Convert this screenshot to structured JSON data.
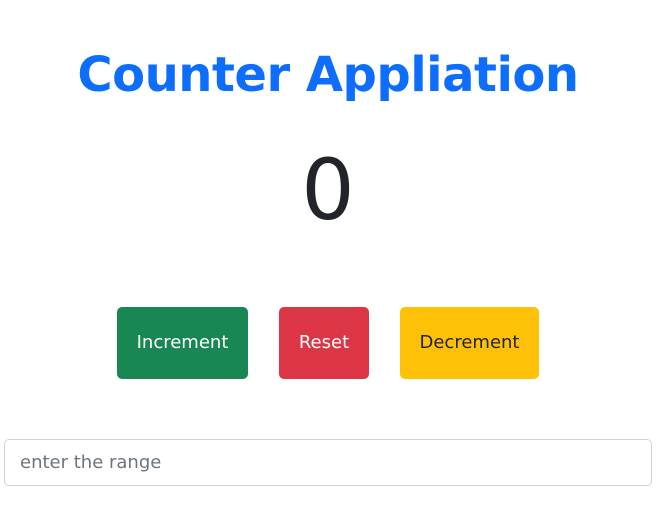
{
  "header": {
    "title": "Counter Appliation"
  },
  "counter": {
    "value": "0"
  },
  "controls": {
    "increment_label": "Increment",
    "reset_label": "Reset",
    "decrement_label": "Decrement"
  },
  "range": {
    "placeholder": "enter the range",
    "value": ""
  },
  "colors": {
    "title": "#0d6efd",
    "count": "#212529",
    "increment": "#198754",
    "reset": "#dc3545",
    "decrement": "#ffc107",
    "increment_text": "#ffffff",
    "reset_text": "#ffffff",
    "decrement_text": "#212529"
  }
}
